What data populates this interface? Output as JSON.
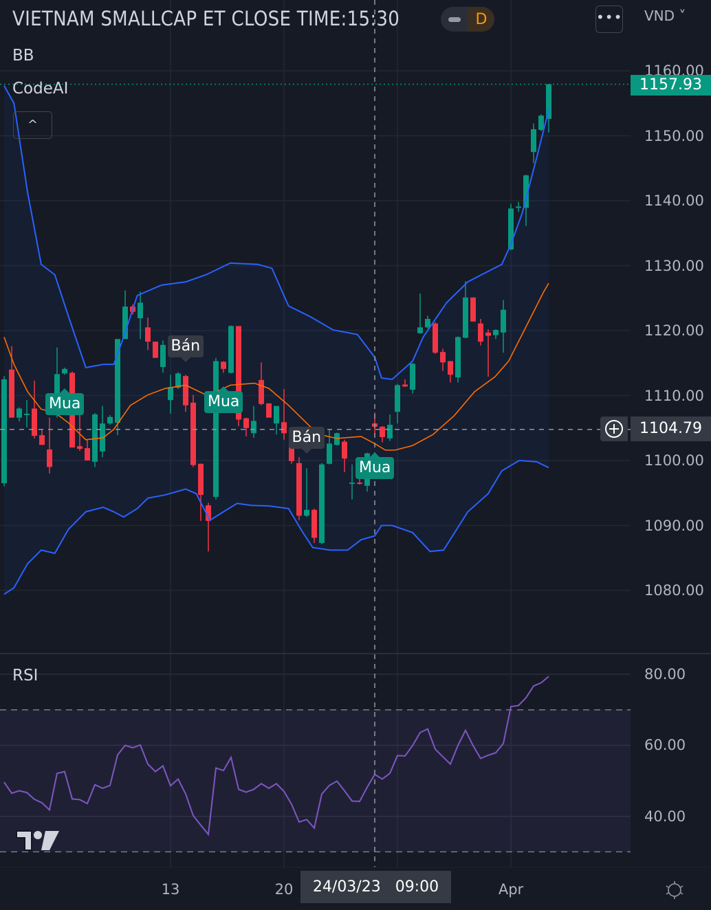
{
  "header": {
    "title": "VIETNAM SMALLCAP ET CLOSE TIME:15:30",
    "interval_badge": "D",
    "more_button": "•••",
    "currency": "VND ˅"
  },
  "legend": {
    "bb": "BB",
    "codeai": "CodeAI",
    "collapse_icon": "^",
    "rsi": "RSI"
  },
  "colors": {
    "up": "#089981",
    "down": "#F23645",
    "band": "#2962FF",
    "basis": "#FF6D00",
    "rsi": "#7E57C2"
  },
  "price_axis": {
    "ticks": [
      "1160.00",
      "1150.00",
      "1140.00",
      "1130.00",
      "1120.00",
      "1110.00",
      "1100.00",
      "1090.00",
      "1080.00"
    ],
    "last_price": "1157.93",
    "crosshair_price": "1104.79"
  },
  "rsi_axis": {
    "ticks": [
      "80.00",
      "60.00",
      "40.00"
    ]
  },
  "time_axis": {
    "labels": [
      {
        "text": "13",
        "bar": 22
      },
      {
        "text": "20",
        "bar": 37
      },
      {
        "text": "Apr",
        "bar": 67
      }
    ],
    "crosshair_date": "24/03/23   09:00"
  },
  "chart_data": {
    "type": "candlestick",
    "title": "VIETNAM SMALLCAP ET CLOSE TIME:15:30",
    "ylim": [
      1075,
      1165
    ],
    "crosshair": {
      "bar": 49,
      "price": 1104.79
    },
    "ohlc": [
      [
        1096.5,
        1113,
        1096,
        1112.5
      ],
      [
        1114,
        1117.6,
        1106.6,
        1106.6
      ],
      [
        1106.6,
        1108.2,
        1106,
        1108
      ],
      [
        1107,
        1109.3,
        1105.1,
        1107.2
      ],
      [
        1108,
        1112.3,
        1103.4,
        1103.8
      ],
      [
        1103.9,
        1104.8,
        1102.4,
        1102.4
      ],
      [
        1101.7,
        1106.6,
        1098,
        1099
      ],
      [
        1107.4,
        1117.4,
        1106.6,
        1113.3
      ],
      [
        1113.4,
        1114.3,
        1113.2,
        1114.1
      ],
      [
        1113.5,
        1113.7,
        1102,
        1102
      ],
      [
        1102.2,
        1107,
        1101.5,
        1101.8
      ],
      [
        1101.9,
        1103.2,
        1100,
        1100
      ],
      [
        1099.8,
        1107.3,
        1099,
        1107.1
      ],
      [
        1101.4,
        1108.4,
        1100.5,
        1105.7
      ],
      [
        1105.7,
        1107,
        1105.5,
        1106.7
      ],
      [
        1105.8,
        1118.7,
        1103.9,
        1118.7
      ],
      [
        1118.7,
        1126.2,
        1118.7,
        1123.7
      ],
      [
        1123.7,
        1124,
        1122.5,
        1122.9
      ],
      [
        1121.9,
        1126,
        1118.7,
        1124.3
      ],
      [
        1120.5,
        1122,
        1117,
        1118.3
      ],
      [
        1118.3,
        1118.3,
        1115.8,
        1115.8
      ],
      [
        1114.4,
        1118.5,
        1113.5,
        1117.8
      ],
      [
        1109.3,
        1113.2,
        1107.2,
        1111.3
      ],
      [
        1111.2,
        1113.6,
        1111,
        1113.4
      ],
      [
        1113,
        1113.2,
        1107.5,
        1108.5
      ],
      [
        1108.9,
        1110.1,
        1099,
        1099.3
      ],
      [
        1099.5,
        1099.5,
        1090.7,
        1094.7
      ],
      [
        1093.1,
        1093.5,
        1086,
        1090.7
      ],
      [
        1094.4,
        1115.8,
        1094,
        1115.3
      ],
      [
        1115.2,
        1115.3,
        1113.5,
        1114.1
      ],
      [
        1113.5,
        1120.8,
        1113.4,
        1120.7
      ],
      [
        1120.7,
        1120.7,
        1105.3,
        1106.3
      ],
      [
        1106.5,
        1106.6,
        1103.7,
        1105
      ],
      [
        1104.2,
        1108.4,
        1103.5,
        1106.1
      ],
      [
        1112.4,
        1115.1,
        1108.5,
        1108.7
      ],
      [
        1108.8,
        1108.8,
        1106.6,
        1106.6
      ],
      [
        1105.7,
        1108.4,
        1104,
        1108.4
      ],
      [
        1105.9,
        1111,
        1103.2,
        1104.2
      ],
      [
        1104.6,
        1104.7,
        1099.5,
        1099.9
      ],
      [
        1099.6,
        1100.5,
        1090.8,
        1091.5
      ],
      [
        1091.5,
        1098.8,
        1091.3,
        1092.4
      ],
      [
        1092.4,
        1092.6,
        1087.3,
        1088.1
      ],
      [
        1087.3,
        1099.6,
        1087.1,
        1099.4
      ],
      [
        1099.5,
        1104.8,
        1099.4,
        1102.6
      ],
      [
        1102.4,
        1104.3,
        1102.3,
        1104.2
      ],
      [
        1102.9,
        1103.2,
        1098.2,
        1100.3
      ],
      [
        1096.5,
        1099.4,
        1094,
        1096.6
      ],
      [
        1096.6,
        1097.4,
        1096.3,
        1096.4
      ],
      [
        1096.1,
        1101.2,
        1095.2,
        1101.1
      ],
      [
        1105.7,
        1107.4,
        1103.8,
        1105.2
      ],
      [
        1105.2,
        1105.3,
        1102.8,
        1103.6
      ],
      [
        1103.4,
        1107.1,
        1103,
        1105.5
      ],
      [
        1107.5,
        1111.8,
        1105.7,
        1111.6
      ],
      [
        1111.7,
        1112.5,
        1111.3,
        1111.4
      ],
      [
        1110.9,
        1115,
        1110.3,
        1114.9
      ],
      [
        1119.6,
        1125.7,
        1119.5,
        1120.5
      ],
      [
        1120.5,
        1122.3,
        1120.3,
        1121.8
      ],
      [
        1121.1,
        1121.3,
        1116.4,
        1116.6
      ],
      [
        1116.7,
        1117.2,
        1113.8,
        1115.1
      ],
      [
        1115.3,
        1115.3,
        1112,
        1113.2
      ],
      [
        1112.8,
        1119.1,
        1112,
        1119
      ],
      [
        1118.9,
        1127.6,
        1118.8,
        1125.1
      ],
      [
        1125.1,
        1125.1,
        1121.4,
        1121.4
      ],
      [
        1121.1,
        1121.8,
        1117.7,
        1118.3
      ],
      [
        1119.7,
        1120.2,
        1112.9,
        1119.2
      ],
      [
        1119.3,
        1120.2,
        1118.7,
        1120.1
      ],
      [
        1119.7,
        1124.7,
        1116.6,
        1123.2
      ],
      [
        1132.5,
        1139.5,
        1132.4,
        1138.8
      ],
      [
        1138.9,
        1139.8,
        1138.3,
        1139.1
      ],
      [
        1138.9,
        1144,
        1136.1,
        1143.9
      ],
      [
        1147.5,
        1151.9,
        1145.8,
        1151
      ],
      [
        1150.9,
        1153.3,
        1150.7,
        1153.1
      ],
      [
        1152.6,
        1157.93,
        1150.5,
        1157.93
      ]
    ],
    "bb_upper": [
      [
        0,
        1157.7
      ],
      [
        1.3,
        1155
      ],
      [
        3.1,
        1141.3
      ],
      [
        4.9,
        1130.2
      ],
      [
        6.7,
        1128.6
      ],
      [
        8.5,
        1122.2
      ],
      [
        10.8,
        1114.3
      ],
      [
        13.1,
        1114.8
      ],
      [
        14.5,
        1114.8
      ],
      [
        15.8,
        1119
      ],
      [
        17.6,
        1125.4
      ],
      [
        20.8,
        1127
      ],
      [
        24,
        1127.5
      ],
      [
        26.7,
        1128.6
      ],
      [
        29.9,
        1130.4
      ],
      [
        33.5,
        1130.2
      ],
      [
        35.4,
        1129.6
      ],
      [
        37.6,
        1123.8
      ],
      [
        40.4,
        1122.2
      ],
      [
        43.5,
        1120.1
      ],
      [
        46.7,
        1119.4
      ],
      [
        49,
        1115.9
      ],
      [
        49.9,
        1112.7
      ],
      [
        51.3,
        1112.5
      ],
      [
        54,
        1115.3
      ],
      [
        55.4,
        1119
      ],
      [
        58.5,
        1124.3
      ],
      [
        61.3,
        1127.5
      ],
      [
        63.1,
        1128.6
      ],
      [
        65.8,
        1130.2
      ],
      [
        67,
        1133.3
      ],
      [
        68.5,
        1138.1
      ],
      [
        70.4,
        1146.6
      ],
      [
        72,
        1154
      ]
    ],
    "bb_basis": [
      [
        0,
        1119
      ],
      [
        1.3,
        1114.8
      ],
      [
        3.1,
        1110.6
      ],
      [
        4.9,
        1107.9
      ],
      [
        6.7,
        1107.4
      ],
      [
        8.5,
        1105.8
      ],
      [
        10.8,
        1103.2
      ],
      [
        13.1,
        1103.5
      ],
      [
        14.5,
        1104.8
      ],
      [
        16.7,
        1108.5
      ],
      [
        19,
        1110.1
      ],
      [
        21.3,
        1111.1
      ],
      [
        24,
        1111.6
      ],
      [
        26.7,
        1110.1
      ],
      [
        28.1,
        1110.6
      ],
      [
        29.9,
        1111.6
      ],
      [
        33.1,
        1111.9
      ],
      [
        35,
        1111.1
      ],
      [
        37.6,
        1108.5
      ],
      [
        40.4,
        1105.3
      ],
      [
        41.7,
        1104
      ],
      [
        44,
        1103.4
      ],
      [
        47.2,
        1103.7
      ],
      [
        49,
        1102.6
      ],
      [
        50.4,
        1101.6
      ],
      [
        51.7,
        1101.6
      ],
      [
        54,
        1102.3
      ],
      [
        56.7,
        1104
      ],
      [
        59.5,
        1106.9
      ],
      [
        62.2,
        1110.6
      ],
      [
        64.9,
        1112.9
      ],
      [
        66.7,
        1115.3
      ],
      [
        69,
        1120.6
      ],
      [
        71.3,
        1125.9
      ],
      [
        72,
        1127.3
      ]
    ],
    "bb_lower": [
      [
        0,
        1079.4
      ],
      [
        1.3,
        1080.4
      ],
      [
        3.1,
        1084.1
      ],
      [
        4.9,
        1086.2
      ],
      [
        6.7,
        1085.7
      ],
      [
        8.5,
        1089.4
      ],
      [
        10.8,
        1092.1
      ],
      [
        13.1,
        1092.8
      ],
      [
        14.5,
        1092.1
      ],
      [
        15.8,
        1091.3
      ],
      [
        17.6,
        1092.6
      ],
      [
        19,
        1094.2
      ],
      [
        21.3,
        1094.7
      ],
      [
        24,
        1095.6
      ],
      [
        25.4,
        1094.9
      ],
      [
        27.2,
        1090.8
      ],
      [
        29,
        1092.1
      ],
      [
        30.8,
        1093.4
      ],
      [
        32.6,
        1093.1
      ],
      [
        35,
        1093
      ],
      [
        37.6,
        1092.6
      ],
      [
        39.5,
        1088.9
      ],
      [
        40.8,
        1086.6
      ],
      [
        43.1,
        1086.2
      ],
      [
        45.4,
        1086.2
      ],
      [
        47.2,
        1087.8
      ],
      [
        49,
        1088.4
      ],
      [
        49.9,
        1090
      ],
      [
        51.3,
        1090
      ],
      [
        54,
        1088.9
      ],
      [
        56.3,
        1086
      ],
      [
        58.1,
        1086.2
      ],
      [
        61.3,
        1092.1
      ],
      [
        64,
        1094.9
      ],
      [
        65.8,
        1098.4
      ],
      [
        68.1,
        1100
      ],
      [
        70.4,
        1099.8
      ],
      [
        72,
        1098.9
      ]
    ],
    "signals": [
      {
        "type": "buy",
        "text": "Mua",
        "bar": 8,
        "price": 1111.1
      },
      {
        "type": "sell",
        "text": "Bán",
        "bar": 24,
        "price": 1115.1
      },
      {
        "type": "buy",
        "text": "Mua",
        "bar": 29,
        "price": 1111.4
      },
      {
        "type": "sell",
        "text": "Bán",
        "bar": 40,
        "price": 1101.1
      },
      {
        "type": "buy",
        "text": "Mua",
        "bar": 49,
        "price": 1101.3
      }
    ],
    "rsi": {
      "overbought": 70,
      "oversold": 30,
      "ylim": [
        25,
        85
      ],
      "values": [
        49.6,
        46.5,
        47.2,
        46.7,
        44.8,
        43.8,
        41.8,
        52.1,
        52.6,
        44.9,
        44.7,
        43.6,
        48.9,
        47.9,
        48.7,
        57.3,
        60.0,
        59.3,
        60.1,
        54.7,
        52.6,
        54.2,
        48.6,
        50.5,
        46.3,
        40.2,
        37.5,
        34.9,
        53.6,
        52.9,
        56.6,
        47.6,
        46.8,
        47.6,
        49.2,
        47.9,
        49.2,
        47.0,
        43.4,
        38.4,
        39.1,
        36.7,
        46.3,
        48.7,
        49.9,
        47.2,
        44.3,
        44.2,
        48.2,
        51.8,
        50.5,
        52.1,
        57.1,
        57.0,
        59.9,
        63.6,
        64.6,
        58.9,
        56.8,
        54.7,
        60.0,
        64.2,
        59.9,
        56.3,
        57.2,
        57.9,
        60.5,
        70.9,
        71.2,
        73.4,
        76.7,
        77.6,
        79.4
      ]
    }
  }
}
